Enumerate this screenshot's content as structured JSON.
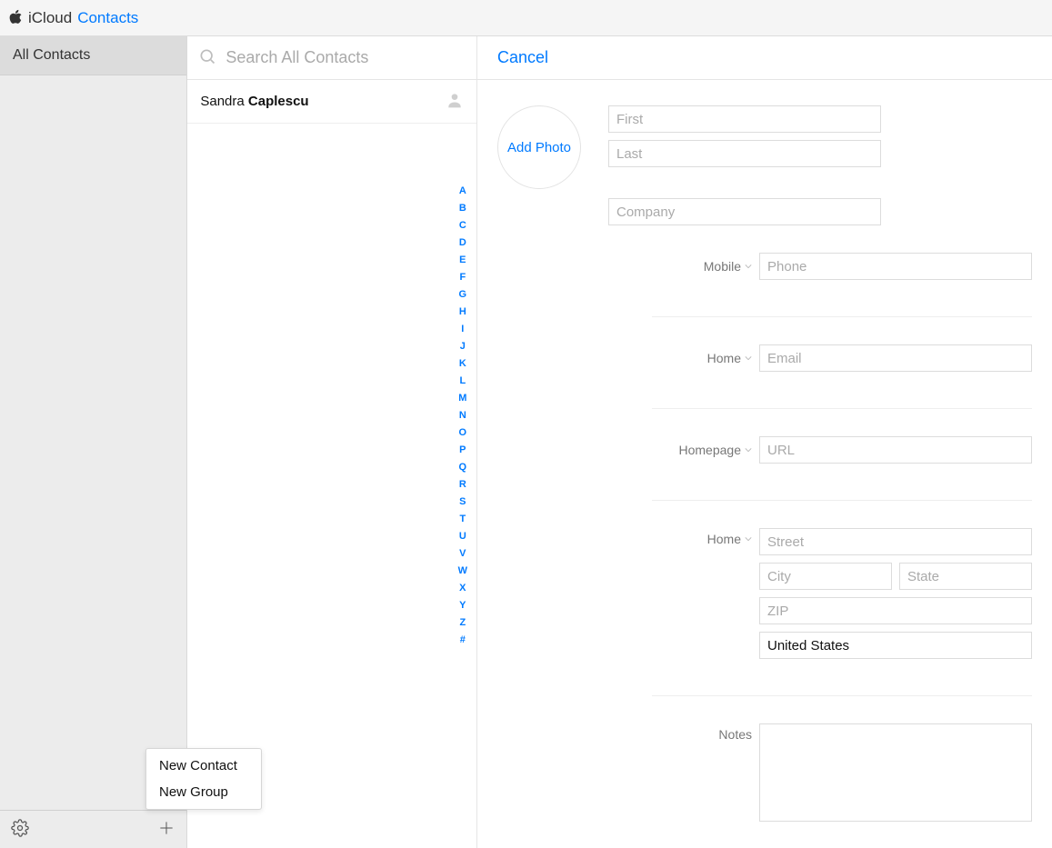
{
  "banner": {
    "title1": "iCloud",
    "title2": "Contacts"
  },
  "sidebar": {
    "all_contacts": "All Contacts"
  },
  "popup": {
    "new_contact": "New Contact",
    "new_group": "New Group"
  },
  "search": {
    "placeholder": "Search All Contacts"
  },
  "contacts": [
    {
      "first": "Sandra",
      "last": "Caplescu"
    }
  ],
  "az_index": [
    "A",
    "B",
    "C",
    "D",
    "E",
    "F",
    "G",
    "H",
    "I",
    "J",
    "K",
    "L",
    "M",
    "N",
    "O",
    "P",
    "Q",
    "R",
    "S",
    "T",
    "U",
    "V",
    "W",
    "X",
    "Y",
    "Z",
    "#"
  ],
  "detail": {
    "cancel": "Cancel",
    "add_photo": "Add Photo",
    "placeholders": {
      "first": "First",
      "last": "Last",
      "company": "Company",
      "phone": "Phone",
      "email": "Email",
      "url": "URL",
      "street": "Street",
      "city": "City",
      "state": "State",
      "zip": "ZIP"
    },
    "labels": {
      "mobile": "Mobile",
      "home_email": "Home",
      "homepage": "Homepage",
      "home_addr": "Home",
      "notes": "Notes"
    },
    "values": {
      "country": "United States"
    }
  }
}
